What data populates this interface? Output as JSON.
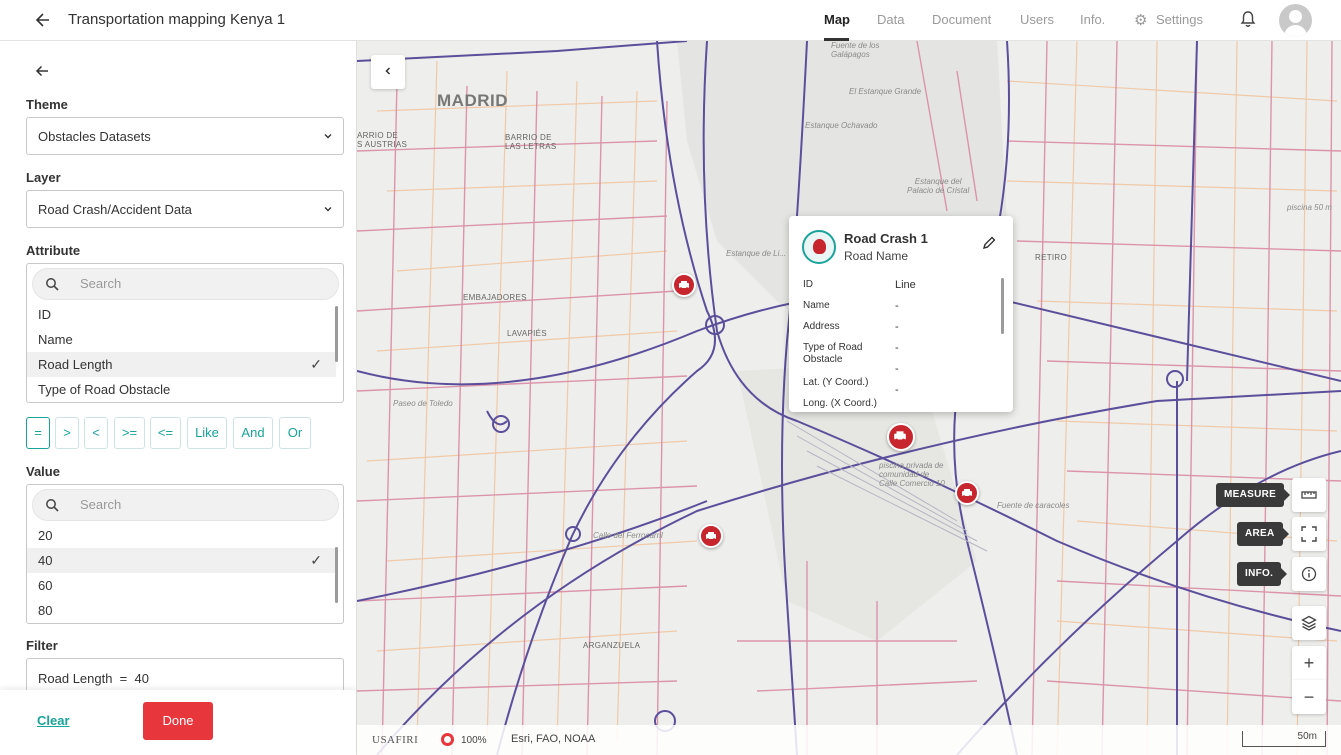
{
  "header": {
    "title": "Transportation mapping Kenya 1",
    "nav": [
      "Map",
      "Data",
      "Document",
      "Users",
      "Info."
    ],
    "settings_label": "Settings"
  },
  "sidebar": {
    "theme": {
      "label": "Theme",
      "value": "Obstacles Datasets"
    },
    "layer": {
      "label": "Layer",
      "value": "Road Crash/Accident Data"
    },
    "attribute": {
      "label": "Attribute",
      "search_placeholder": "Search",
      "items": [
        "ID",
        "Name",
        "Road Length",
        "Type of Road Obstacle"
      ],
      "selected": "Road Length"
    },
    "operators": [
      "=",
      ">",
      "<",
      ">=",
      "<=",
      "Like",
      "And",
      "Or"
    ],
    "value": {
      "label": "Value",
      "search_placeholder": "Search",
      "items": [
        "20",
        "40",
        "60",
        "80"
      ],
      "selected": "40"
    },
    "filter": {
      "label": "Filter",
      "value": "Road Length  =  40"
    },
    "clear_label": "Clear",
    "done_label": "Done"
  },
  "map": {
    "labels": {
      "madrid": "MADRID",
      "arrico": "ARRIO DE\nS AUSTRIAS",
      "barrio_letras": "BARRIO DE\nLAS LETRAS",
      "embajadores": "EMBAJADORES",
      "lavapies": "LAVAPIÉS",
      "arganzuela": "ARGANZUELA",
      "retiro": "RETIRO",
      "fuente": "Fuente de los\nGalápagos",
      "estanque_grande": "El Estanque Grande",
      "estanque_ochavado": "Estanque Ochavado",
      "palacio": "Estanque del\nPalacio de Cristal",
      "piscina": "piscina 50 m",
      "estanque_li": "Estanque de Li...",
      "paseo_toledo": "Paseo de Toledo",
      "calle_ferrocarril": "Calle del Ferrocarril",
      "piscina_privada": "piscina privada de\ncomunidad de\nCalle Comercio 10",
      "fuente_caracoles": "Fuente de caracoles"
    },
    "popup": {
      "title": "Road Crash 1",
      "subtitle": "Road Name",
      "fields": [
        {
          "key": "ID",
          "value": "Line"
        },
        {
          "key": "Name",
          "value": "-"
        },
        {
          "key": "Address",
          "value": "-"
        },
        {
          "key": "Type of Road Obstacle",
          "value": "-"
        },
        {
          "key": "",
          "value": "-"
        },
        {
          "key": "Lat. (Y Coord.)",
          "value": "-"
        },
        {
          "key": "Long. (X Coord.)",
          "value": ""
        }
      ]
    },
    "tools": {
      "measure_tip": "MEASURE",
      "area_tip": "AREA",
      "info_tip": "INFO.",
      "zoom_in": "+",
      "zoom_out": "−"
    },
    "status": {
      "brand": "USAFIRI",
      "zoom_pct": "100%",
      "attribution": "Esri, FAO, NOAA",
      "scale": "50m"
    }
  }
}
